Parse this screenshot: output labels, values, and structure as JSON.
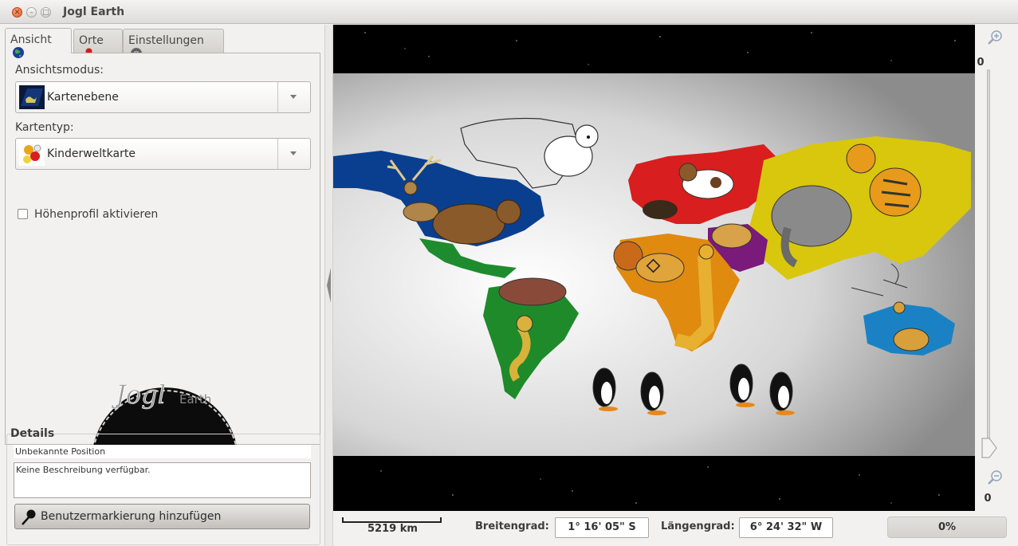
{
  "window": {
    "title": "Jogl Earth"
  },
  "tabs": [
    {
      "label": "Ansicht",
      "icon": "globe-icon"
    },
    {
      "label": "Orte",
      "icon": "pin-icon"
    },
    {
      "label": "Einstellungen",
      "icon": "gear-icon"
    }
  ],
  "view_tab": {
    "view_mode_label": "Ansichtsmodus:",
    "view_mode_value": "Kartenebene",
    "map_type_label": "Kartentyp:",
    "map_type_value": "Kinderweltkarte",
    "elevation_checkbox_label": "Höhenprofil aktivieren",
    "elevation_checked": false,
    "logo_text": "Jogl",
    "logo_subtext": "Earth"
  },
  "details": {
    "title": "Details",
    "position": "Unbekannte Position",
    "description": "Keine Beschreibung verfügbar.",
    "add_marker_label": "Benutzermarkierung hinzufügen"
  },
  "zoom": {
    "top_value": "0",
    "bottom_value": "0"
  },
  "statusbar": {
    "scale": "5219 km",
    "latitude_label": "Breitengrad:",
    "latitude_value": "1° 16' 05\" S",
    "longitude_label": "Längengrad:",
    "longitude_value": "6° 24' 32\" W",
    "progress": "0%"
  },
  "colors": {
    "north_america": "#0a3f8f",
    "central_america": "#1e8c2e",
    "south_america": "#1f8a2a",
    "europe": "#d81e1e",
    "asia": "#d8c70c",
    "africa": "#e08a10",
    "middle_east": "#7a1a7a",
    "australia": "#1a82c4"
  }
}
